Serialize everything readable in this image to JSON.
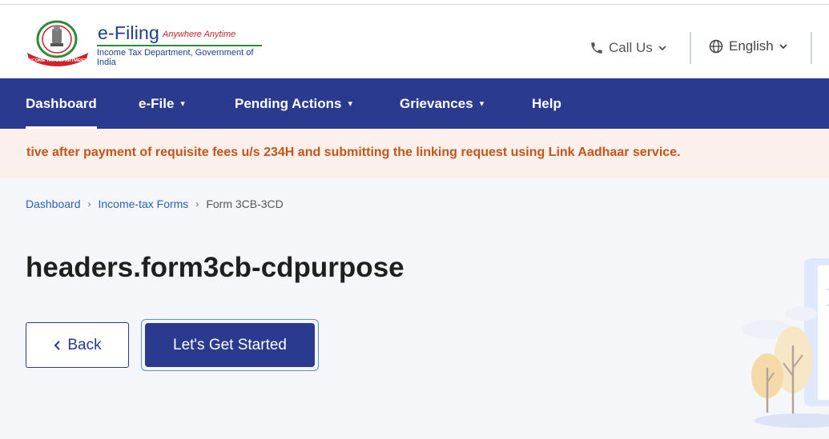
{
  "brand": {
    "title": "e-Filing",
    "tagline": "Anywhere Anytime",
    "subtitle": "Income Tax Department, Government of India",
    "emblem_text": "INCOME TAX DEPARTMENT"
  },
  "header": {
    "call_us_label": "Call Us",
    "language_label": "English"
  },
  "nav": {
    "items": [
      {
        "label": "Dashboard",
        "dropdown": false,
        "active": true
      },
      {
        "label": "e-File",
        "dropdown": true
      },
      {
        "label": "Pending Actions",
        "dropdown": true
      },
      {
        "label": "Grievances",
        "dropdown": true
      },
      {
        "label": "Help",
        "dropdown": false
      }
    ]
  },
  "ticker": {
    "text": "tive after payment of requisite fees u/s 234H and submitting the linking request using Link Aadhaar service."
  },
  "breadcrumb": {
    "items": [
      "Dashboard",
      "Income-tax Forms"
    ],
    "current": "Form 3CB-3CD"
  },
  "page": {
    "title": "headers.form3cb-cdpurpose"
  },
  "actions": {
    "back_label": "Back",
    "start_label": "Let's Get Started"
  },
  "colors": {
    "nav_bg": "#2a3a8f",
    "ticker_bg": "#fbf0ea",
    "ticker_text": "#c4541b",
    "link": "#2a63b6",
    "page_bg": "#f4f6fa"
  }
}
